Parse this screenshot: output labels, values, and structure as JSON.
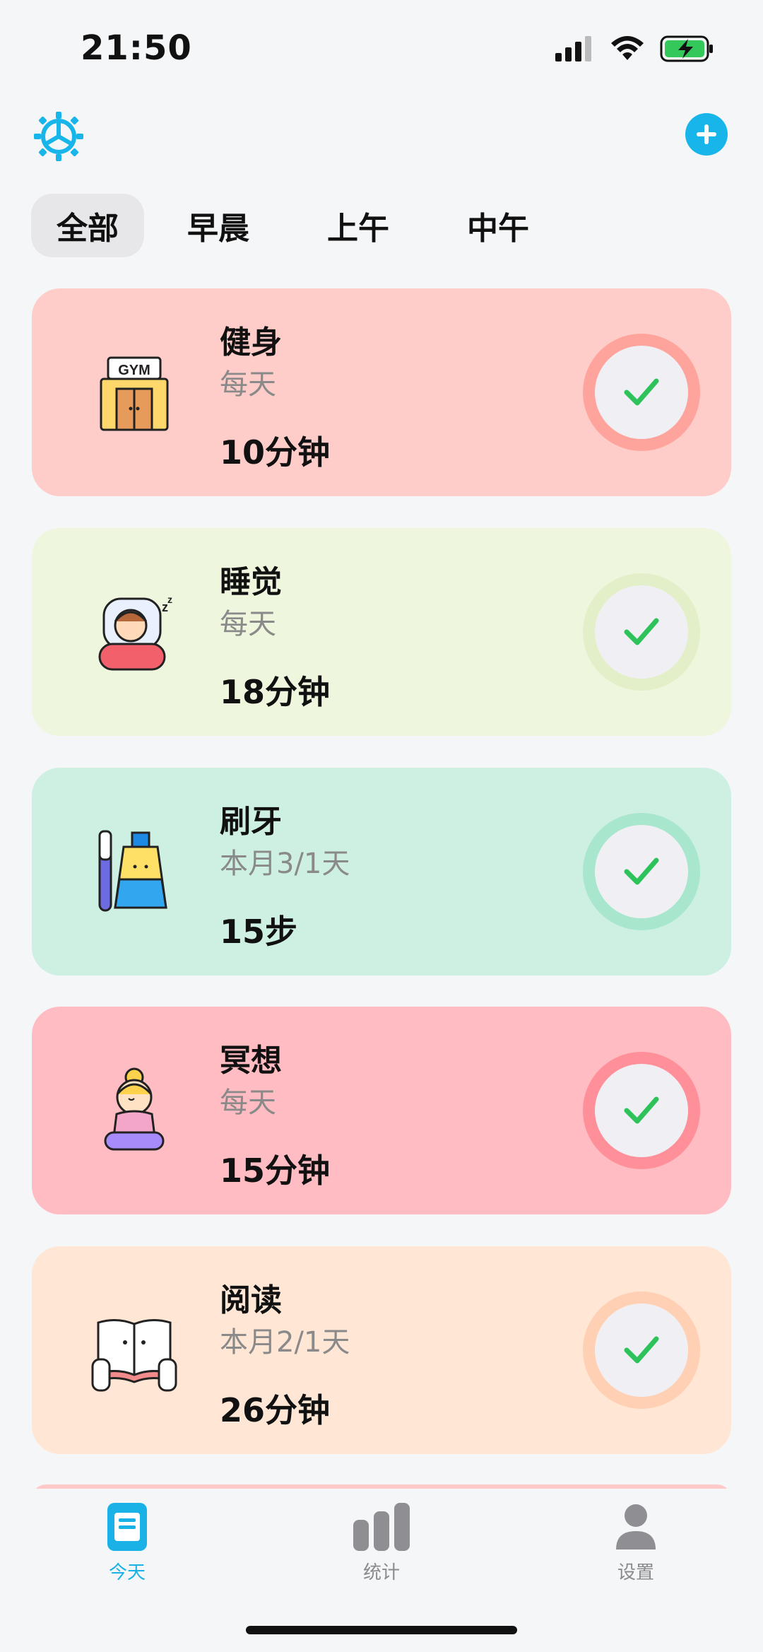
{
  "status_bar": {
    "time": "21:50"
  },
  "tabs": [
    {
      "label": "全部",
      "active": true
    },
    {
      "label": "早晨",
      "active": false
    },
    {
      "label": "上午",
      "active": false
    },
    {
      "label": "中午",
      "active": false
    }
  ],
  "habits": [
    {
      "title": "健身",
      "frequency": "每天",
      "amount": "10分钟",
      "icon": "gym-icon",
      "bg": "#ffcdc9",
      "ring": "#ffa49d"
    },
    {
      "title": "睡觉",
      "frequency": "每天",
      "amount": "18分钟",
      "icon": "sleep-icon",
      "bg": "#eef6dd",
      "ring": "#e3efc8"
    },
    {
      "title": "刷牙",
      "frequency": "本月3/1天",
      "amount": "15步",
      "icon": "toothbrush-icon",
      "bg": "#cdf0e2",
      "ring": "#a8e6cd"
    },
    {
      "title": "冥想",
      "frequency": "每天",
      "amount": "15分钟",
      "icon": "meditation-icon",
      "bg": "#ffbcc2",
      "ring": "#ff8f99"
    },
    {
      "title": "阅读",
      "frequency": "本月2/1天",
      "amount": "26分钟",
      "icon": "reading-icon",
      "bg": "#ffe6d5",
      "ring": "#ffd0b3"
    }
  ],
  "bottom_nav": [
    {
      "label": "今天",
      "icon": "today-icon",
      "active": true
    },
    {
      "label": "统计",
      "icon": "stats-icon",
      "active": false
    },
    {
      "label": "设置",
      "icon": "profile-icon",
      "active": false
    }
  ],
  "colors": {
    "accent": "#17b5ea",
    "check": "#2ec25b"
  }
}
